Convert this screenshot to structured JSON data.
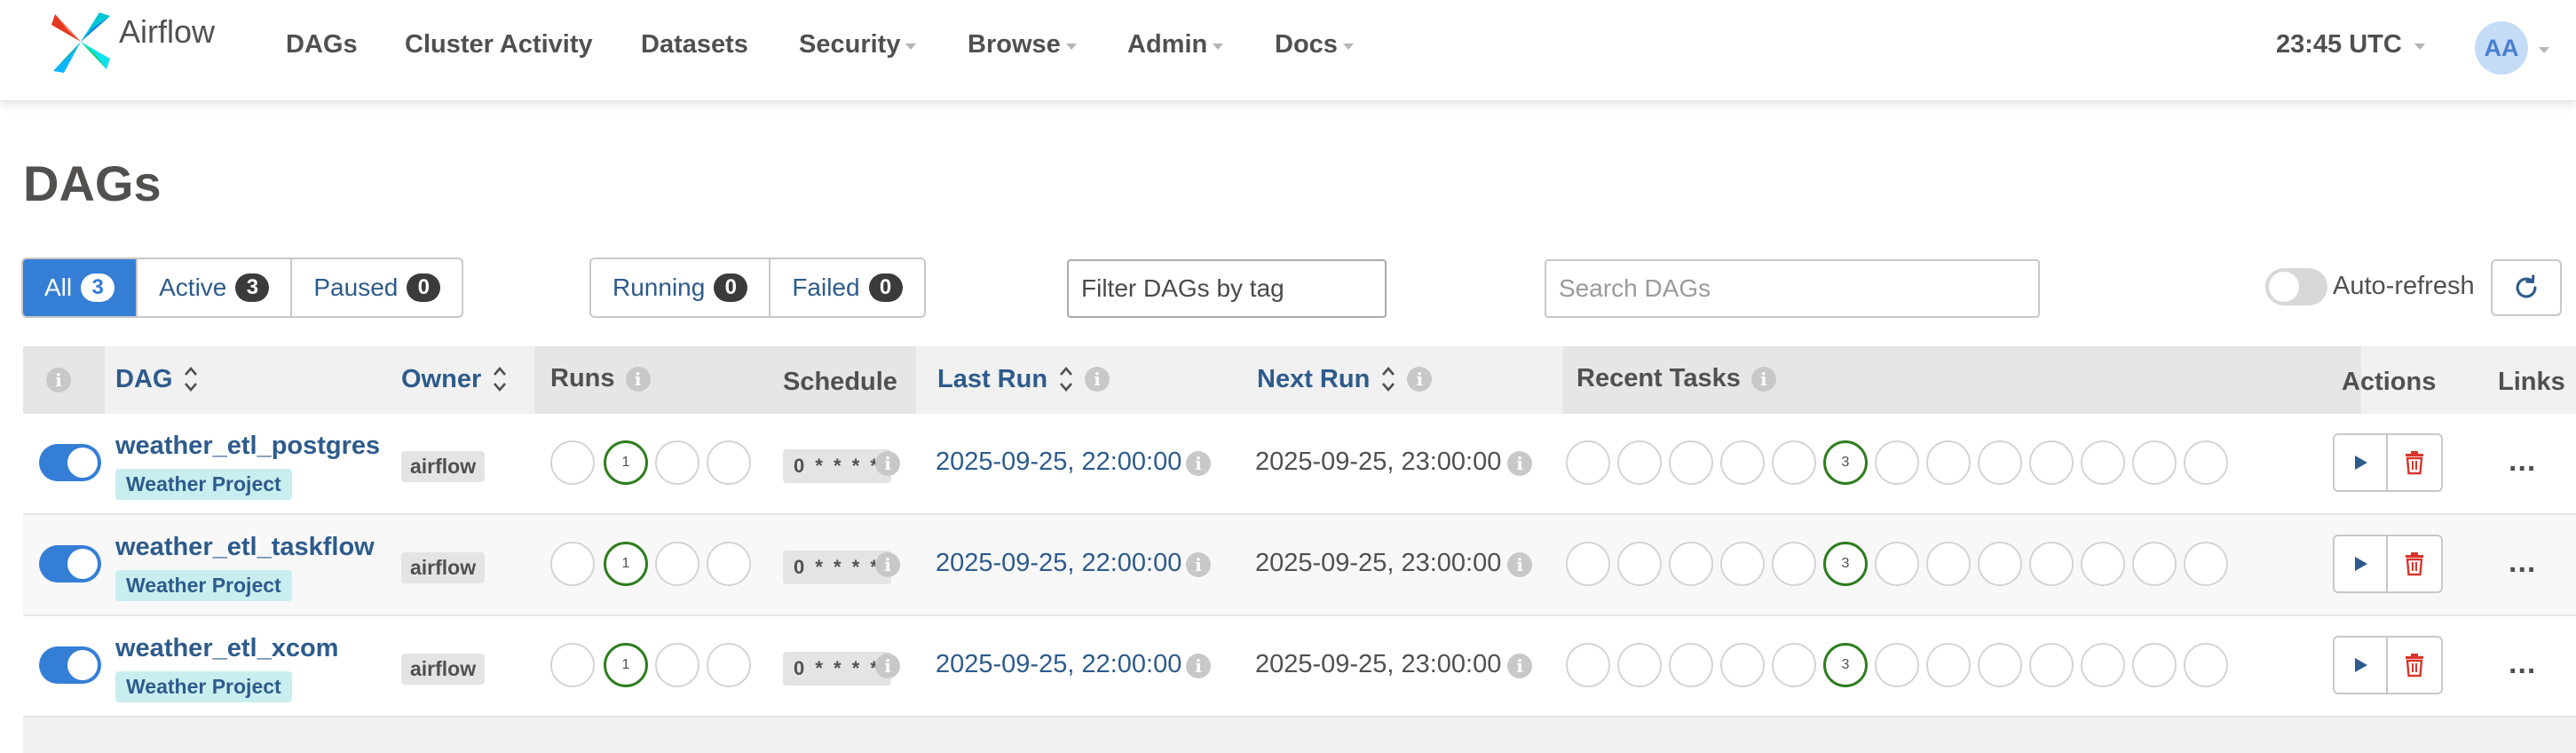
{
  "navbar": {
    "brand": "Airflow",
    "items": [
      {
        "label": "DAGs",
        "dropdown": false
      },
      {
        "label": "Cluster Activity",
        "dropdown": false
      },
      {
        "label": "Datasets",
        "dropdown": false
      },
      {
        "label": "Security",
        "dropdown": true
      },
      {
        "label": "Browse",
        "dropdown": true
      },
      {
        "label": "Admin",
        "dropdown": true
      },
      {
        "label": "Docs",
        "dropdown": true
      }
    ],
    "time": "23:45 UTC",
    "user_initials": "AA"
  },
  "page_title": "DAGs",
  "status_filters": [
    {
      "label": "All",
      "count": "3",
      "active": true
    },
    {
      "label": "Active",
      "count": "3",
      "active": false
    },
    {
      "label": "Paused",
      "count": "0",
      "active": false
    }
  ],
  "run_filters": [
    {
      "label": "Running",
      "count": "0"
    },
    {
      "label": "Failed",
      "count": "0"
    }
  ],
  "tag_filter": {
    "placeholder": "Filter DAGs by tag"
  },
  "search": {
    "placeholder": "Search DAGs"
  },
  "auto_refresh": {
    "label": "Auto-refresh",
    "enabled": false
  },
  "columns": {
    "info": "i",
    "dag": "DAG",
    "owner": "Owner",
    "runs": "Runs",
    "schedule": "Schedule",
    "last_run": "Last Run",
    "next_run": "Next Run",
    "recent_tasks": "Recent Tasks",
    "actions": "Actions",
    "links": "Links"
  },
  "rows": [
    {
      "dag_id": "weather_etl_postgres",
      "tag": "Weather Project",
      "owner": "airflow",
      "runs_success": "1",
      "schedule": "0 * * * *",
      "last_run": "2025-09-25, 22:00:00",
      "next_run": "2025-09-25, 23:00:00",
      "recent_tasks_success": "3",
      "paused": false,
      "links": "..."
    },
    {
      "dag_id": "weather_etl_taskflow",
      "tag": "Weather Project",
      "owner": "airflow",
      "runs_success": "1",
      "schedule": "0 * * * *",
      "last_run": "2025-09-25, 22:00:00",
      "next_run": "2025-09-25, 23:00:00",
      "recent_tasks_success": "3",
      "paused": false,
      "links": "..."
    },
    {
      "dag_id": "weather_etl_xcom",
      "tag": "Weather Project",
      "owner": "airflow",
      "runs_success": "1",
      "schedule": "0 * * * *",
      "last_run": "2025-09-25, 22:00:00",
      "next_run": "2025-09-25, 23:00:00",
      "recent_tasks_success": "3",
      "paused": false,
      "links": "..."
    }
  ],
  "colors": {
    "primary": "#347ed6",
    "link": "#2d5b8c",
    "success": "#2e7d1f",
    "danger": "#d9342b",
    "tag_bg": "#c9eef0"
  }
}
